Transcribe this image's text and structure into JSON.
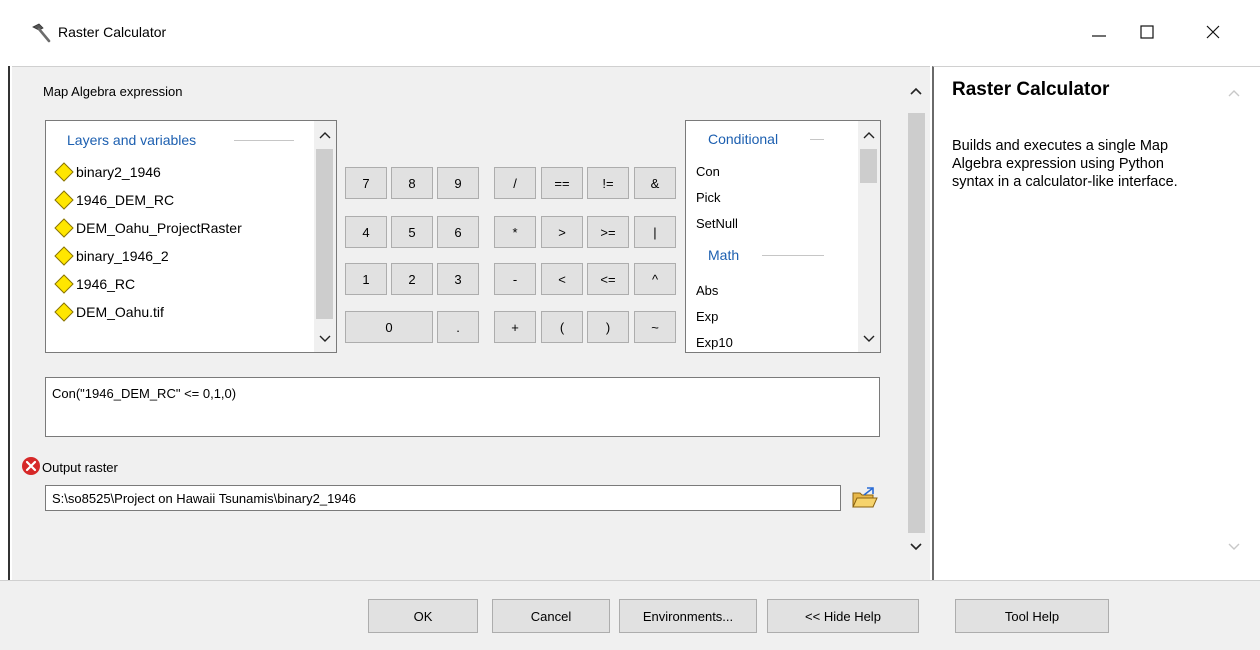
{
  "window": {
    "title": "Raster Calculator",
    "minimize_glyph": "—",
    "maximize_glyph": "☐",
    "close_glyph": "✕"
  },
  "main": {
    "expression_label": "Map Algebra expression",
    "layers": {
      "header": "Layers and variables",
      "items": [
        "binary2_1946",
        "1946_DEM_RC",
        "DEM_Oahu_ProjectRaster",
        "binary_1946_2",
        "1946_RC",
        "DEM_Oahu.tif"
      ]
    },
    "keypad": {
      "k7": "7",
      "k8": "8",
      "k9": "9",
      "k4": "4",
      "k5": "5",
      "k6": "6",
      "k1": "1",
      "k2": "2",
      "k3": "3",
      "k0": "0",
      "kdot": ".",
      "div": "/",
      "eq": "==",
      "neq": "!=",
      "and": "&",
      "mul": "*",
      "gt": ">",
      "gte": ">=",
      "or": "|",
      "sub": "-",
      "lt": "<",
      "lte": "<=",
      "xor": "^",
      "add": "+",
      "lparen": "(",
      "rparen": ")",
      "not": "~"
    },
    "functions": {
      "conditional_header": "Conditional",
      "conditional_items": [
        "Con",
        "Pick",
        "SetNull"
      ],
      "math_header": "Math",
      "math_items": [
        "Abs",
        "Exp",
        "Exp10"
      ]
    },
    "expression": "Con(\"1946_DEM_RC\" <= 0,1,0)",
    "output_label": "Output raster",
    "output_value": "S:\\so8525\\Project on Hawaii Tsunamis\\binary2_1946"
  },
  "help": {
    "title": "Raster Calculator",
    "body": "Builds and executes a single Map Algebra expression using Python syntax in a calculator-like interface."
  },
  "footer": {
    "ok": "OK",
    "cancel": "Cancel",
    "environments": "Environments...",
    "hide_help": "<< Hide Help",
    "tool_help": "Tool Help"
  },
  "colors": {
    "layer_diamond": "#ffe600",
    "list_header": "#1c5fb0",
    "error": "#d62828"
  },
  "icons": {
    "app": "hammer-icon",
    "error": "error-icon",
    "browse": "open-folder-icon",
    "layer": "diamond-icon"
  }
}
